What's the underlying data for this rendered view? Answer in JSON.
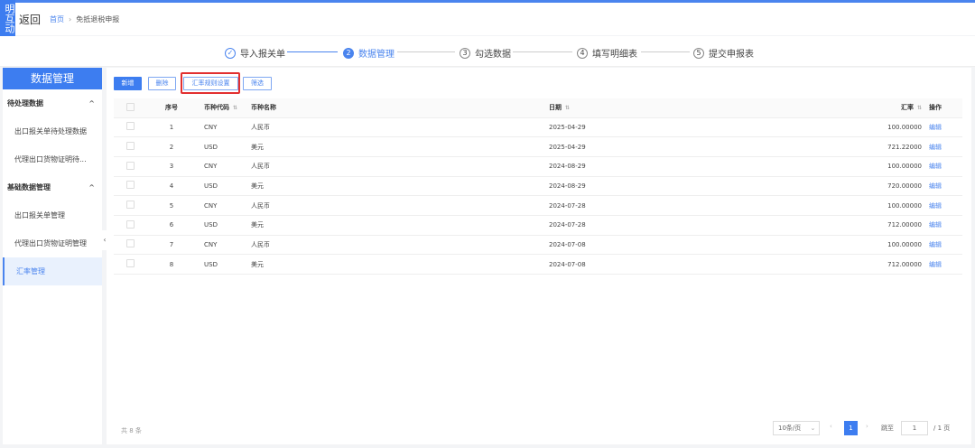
{
  "header": {
    "logo_text": "明互动",
    "back": "返回",
    "breadcrumb": [
      "首页",
      "免抵退税申报"
    ]
  },
  "steps": [
    {
      "num": "✓",
      "label": "导入报关单",
      "state": "done"
    },
    {
      "num": "2",
      "label": "数据管理",
      "state": "active"
    },
    {
      "num": "3",
      "label": "勾选数据",
      "state": "todo"
    },
    {
      "num": "4",
      "label": "填写明细表",
      "state": "todo"
    },
    {
      "num": "5",
      "label": "提交申报表",
      "state": "todo"
    }
  ],
  "sidebar": {
    "title": "数据管理",
    "groups": [
      {
        "label": "待处理数据",
        "items": [
          "出口报关单待处理数据",
          "代理出口货物证明待..."
        ]
      },
      {
        "label": "基础数据管理",
        "items": [
          "出口报关单管理",
          "代理出口货物证明管理",
          "汇率管理"
        ]
      }
    ],
    "active": "汇率管理"
  },
  "toolbar": {
    "add": "新增",
    "delete": "删除",
    "rate_rules": "汇率规则设置",
    "filter": "筛选"
  },
  "table": {
    "headers": {
      "index": "序号",
      "code": "币种代码",
      "name": "币种名称",
      "date": "日期",
      "rate": "汇率",
      "action": "操作"
    },
    "rows": [
      {
        "index": "1",
        "code": "CNY",
        "name": "人民币",
        "date": "2025-04-29",
        "rate": "100.00000",
        "action": "编辑"
      },
      {
        "index": "2",
        "code": "USD",
        "name": "美元",
        "date": "2025-04-29",
        "rate": "721.22000",
        "action": "编辑"
      },
      {
        "index": "3",
        "code": "CNY",
        "name": "人民币",
        "date": "2024-08-29",
        "rate": "100.00000",
        "action": "编辑"
      },
      {
        "index": "4",
        "code": "USD",
        "name": "美元",
        "date": "2024-08-29",
        "rate": "720.00000",
        "action": "编辑"
      },
      {
        "index": "5",
        "code": "CNY",
        "name": "人民币",
        "date": "2024-07-28",
        "rate": "100.00000",
        "action": "编辑"
      },
      {
        "index": "6",
        "code": "USD",
        "name": "美元",
        "date": "2024-07-28",
        "rate": "712.00000",
        "action": "编辑"
      },
      {
        "index": "7",
        "code": "CNY",
        "name": "人民币",
        "date": "2024-07-08",
        "rate": "100.00000",
        "action": "编辑"
      },
      {
        "index": "8",
        "code": "USD",
        "name": "美元",
        "date": "2024-07-08",
        "rate": "712.00000",
        "action": "编辑"
      }
    ]
  },
  "pagination": {
    "total": "共 8 条",
    "page_size": "10条/页",
    "current": "1",
    "goto_label": "跳至",
    "goto_value": "1",
    "pages": "/ 1 页"
  },
  "colors": {
    "accent": "#3d7df0",
    "highlight": "#e23030"
  }
}
